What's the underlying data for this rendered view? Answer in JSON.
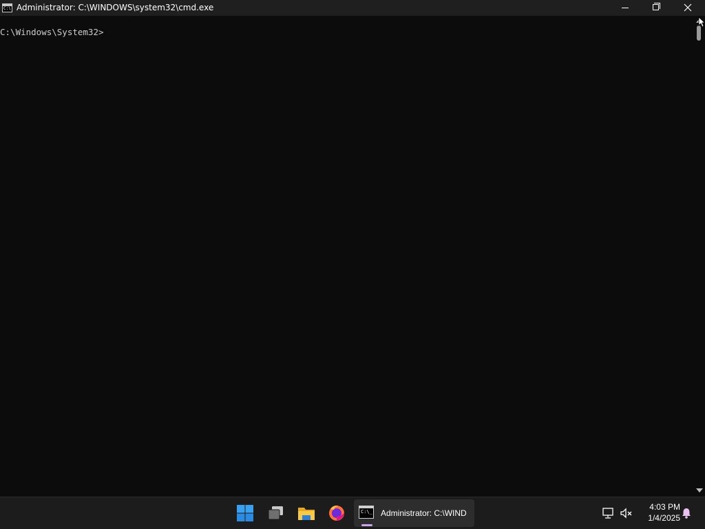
{
  "window": {
    "title": "Administrator: C:\\WINDOWS\\system32\\cmd.exe",
    "icon_text": "C:\\",
    "controls": [
      "minimize",
      "restore",
      "close"
    ]
  },
  "console": {
    "prompt": "C:\\Windows\\System32>",
    "background": "#0c0c0c",
    "foreground": "#cccccc"
  },
  "taskbar": {
    "icons": [
      "windows-start-icon",
      "task-view-icon",
      "file-explorer-icon",
      "firefox-icon"
    ],
    "active_task": {
      "label": "Administrator: C:\\WIND",
      "icon_text": "C:\\_"
    },
    "tray": {
      "time": "4:03 PM",
      "date": "1/4/2025"
    },
    "accent": "#c8a6e6"
  }
}
